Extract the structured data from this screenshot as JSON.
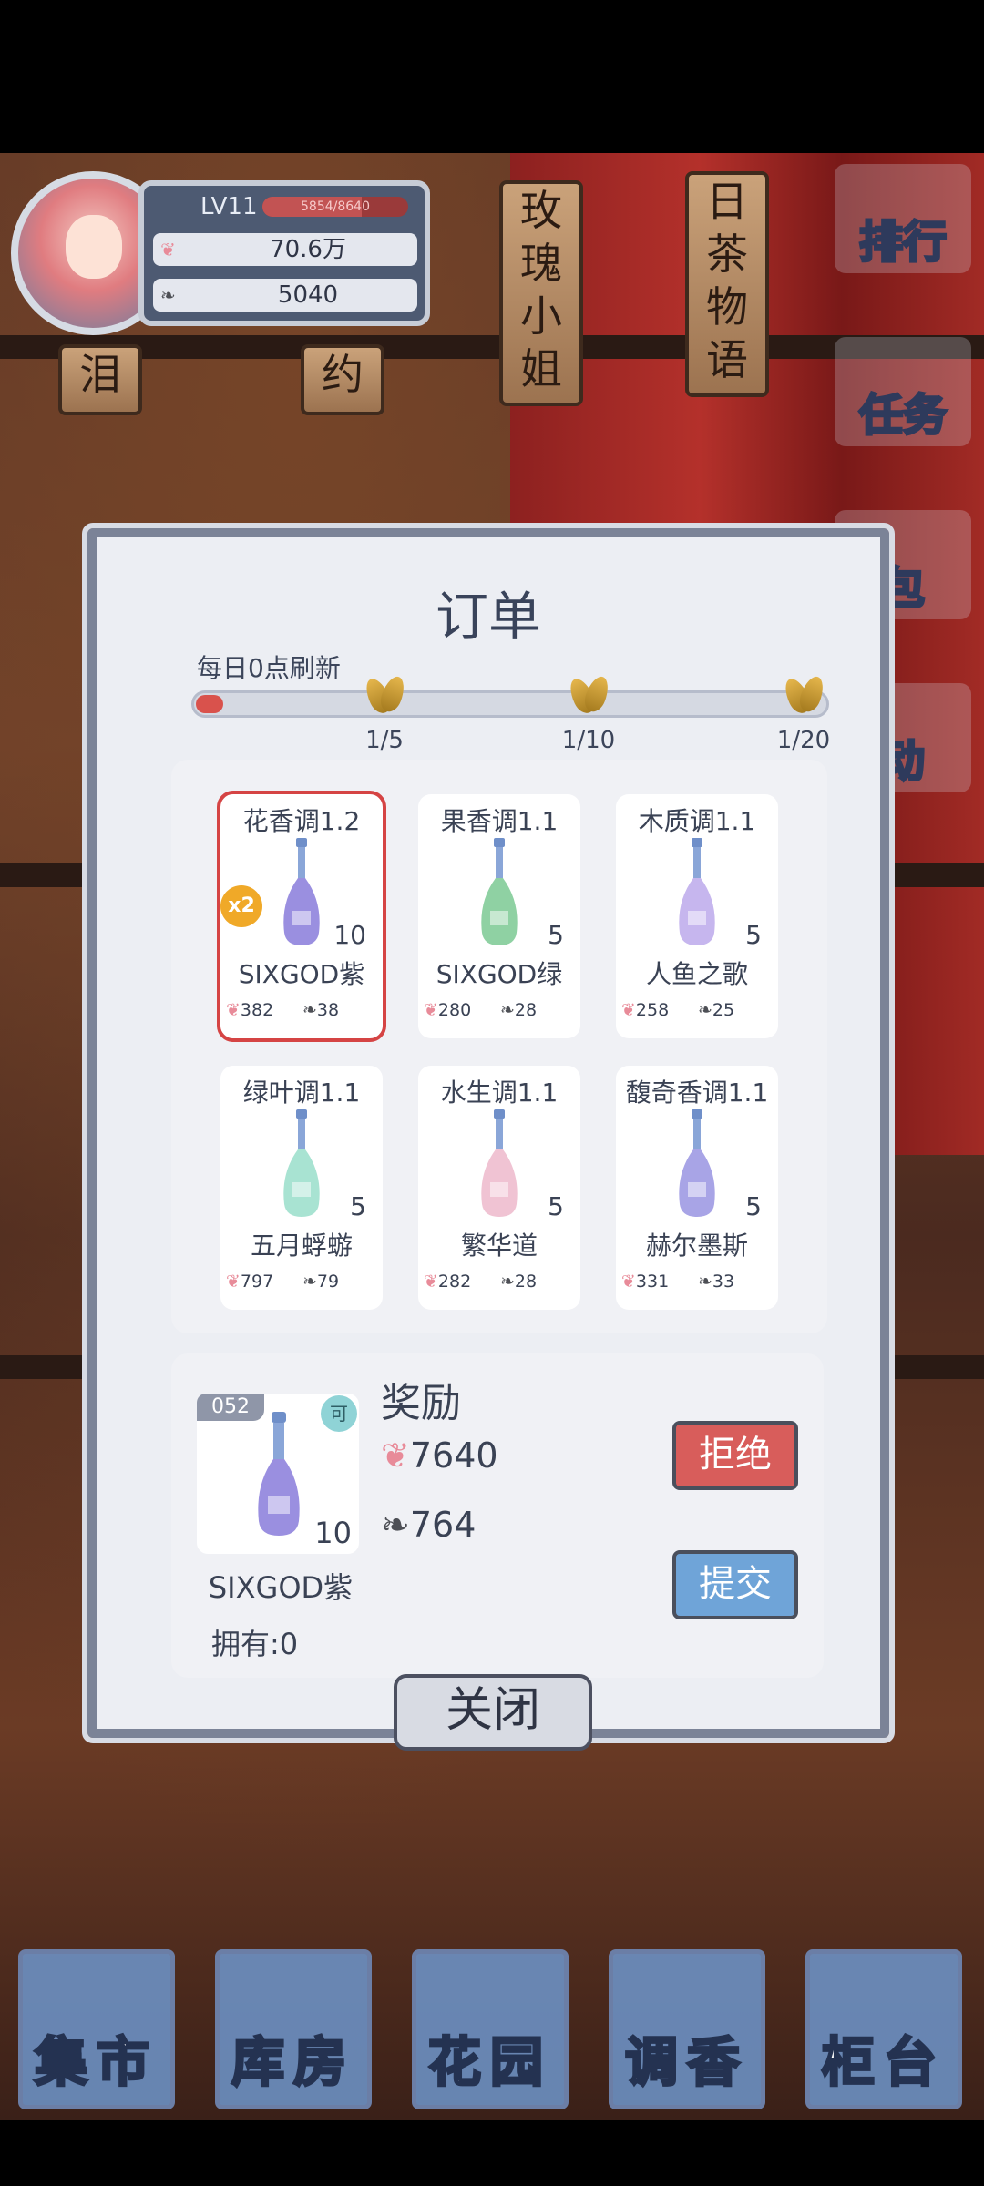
{
  "hud": {
    "level": "LV11",
    "xp_text": "5854/8640",
    "xp_progress": 0.68,
    "petals": "70.6万",
    "leaves": "5040"
  },
  "scene_tags": [
    "玫瑰小姐",
    "日茶物语",
    "泪",
    "约"
  ],
  "side_menu": [
    "排行",
    "任务",
    "包",
    "动"
  ],
  "modal": {
    "title": "订单",
    "refresh_text": "每日0点刷新",
    "progress": 0.02,
    "milestones": [
      "1/5",
      "1/10",
      "1/20"
    ],
    "orders": [
      {
        "note": "花香调1.2",
        "name": "SIXGOD紫",
        "qty": "10",
        "petals": "382",
        "leaves": "38",
        "badge": "x2",
        "color": "#9a8fe0"
      },
      {
        "note": "果香调1.1",
        "name": "SIXGOD绿",
        "qty": "5",
        "petals": "280",
        "leaves": "28",
        "badge": "",
        "color": "#8fd1a3"
      },
      {
        "note": "木质调1.1",
        "name": "人鱼之歌",
        "qty": "5",
        "petals": "258",
        "leaves": "25",
        "badge": "",
        "color": "#c6b6ee"
      },
      {
        "note": "绿叶调1.1",
        "name": "五月蜉蝣",
        "qty": "5",
        "petals": "797",
        "leaves": "79",
        "badge": "",
        "color": "#a8e3d2"
      },
      {
        "note": "水生调1.1",
        "name": "繁华道",
        "qty": "5",
        "petals": "282",
        "leaves": "28",
        "badge": "",
        "color": "#f0c3d3"
      },
      {
        "note": "馥奇香调1.1",
        "name": "赫尔墨斯",
        "qty": "5",
        "petals": "331",
        "leaves": "33",
        "badge": "",
        "color": "#a8a4e6"
      }
    ],
    "reward": {
      "number": "052",
      "can_icon": "可",
      "qty": "10",
      "name": "SIXGOD紫",
      "owned": "拥有:0",
      "title": "奖励",
      "petals": "7640",
      "leaves": "764",
      "reject": "拒绝",
      "submit": "提交"
    },
    "close": "关闭"
  },
  "nav": [
    "集市",
    "库房",
    "花园",
    "调香",
    "柜台"
  ]
}
